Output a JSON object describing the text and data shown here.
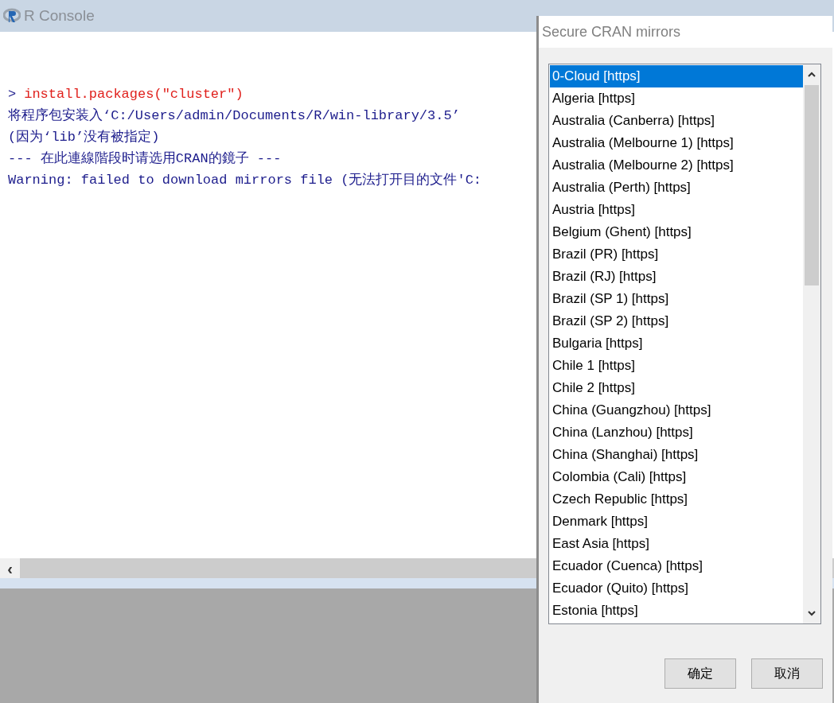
{
  "console": {
    "title": "R Console",
    "lines": [
      {
        "kind": "input",
        "prompt": ">",
        "text": "install.packages(\"cluster\")"
      },
      {
        "kind": "output",
        "text": "将程序包安装入‘C:/Users/admin/Documents/R/win-library/3.5’"
      },
      {
        "kind": "output",
        "text": "(因为‘lib’没有被指定)"
      },
      {
        "kind": "output",
        "text": "--- 在此連線階段时请选用CRAN的鏡子 ---"
      },
      {
        "kind": "output",
        "text": "Warning: failed to download mirrors file (无法打开目的文件'C:"
      }
    ],
    "scroll_left": "‹"
  },
  "dialog": {
    "title": "Secure CRAN mirrors",
    "mirrors": [
      {
        "label": "0-Cloud [https]",
        "selected": true
      },
      {
        "label": "Algeria [https]",
        "selected": false
      },
      {
        "label": "Australia (Canberra) [https]",
        "selected": false
      },
      {
        "label": "Australia (Melbourne 1) [https]",
        "selected": false
      },
      {
        "label": "Australia (Melbourne 2) [https]",
        "selected": false
      },
      {
        "label": "Australia (Perth) [https]",
        "selected": false
      },
      {
        "label": "Austria [https]",
        "selected": false
      },
      {
        "label": "Belgium (Ghent) [https]",
        "selected": false
      },
      {
        "label": "Brazil (PR) [https]",
        "selected": false
      },
      {
        "label": "Brazil (RJ) [https]",
        "selected": false
      },
      {
        "label": "Brazil (SP 1) [https]",
        "selected": false
      },
      {
        "label": "Brazil (SP 2) [https]",
        "selected": false
      },
      {
        "label": "Bulgaria [https]",
        "selected": false
      },
      {
        "label": "Chile 1 [https]",
        "selected": false
      },
      {
        "label": "Chile 2 [https]",
        "selected": false
      },
      {
        "label": "China (Guangzhou) [https]",
        "selected": false
      },
      {
        "label": "China (Lanzhou) [https]",
        "selected": false
      },
      {
        "label": "China (Shanghai) [https]",
        "selected": false
      },
      {
        "label": "Colombia (Cali) [https]",
        "selected": false
      },
      {
        "label": "Czech Republic [https]",
        "selected": false
      },
      {
        "label": "Denmark [https]",
        "selected": false
      },
      {
        "label": "East Asia [https]",
        "selected": false
      },
      {
        "label": "Ecuador (Cuenca) [https]",
        "selected": false
      },
      {
        "label": "Ecuador (Quito) [https]",
        "selected": false
      },
      {
        "label": "Estonia [https]",
        "selected": false
      }
    ],
    "buttons": [
      "确定",
      "取消"
    ]
  }
}
